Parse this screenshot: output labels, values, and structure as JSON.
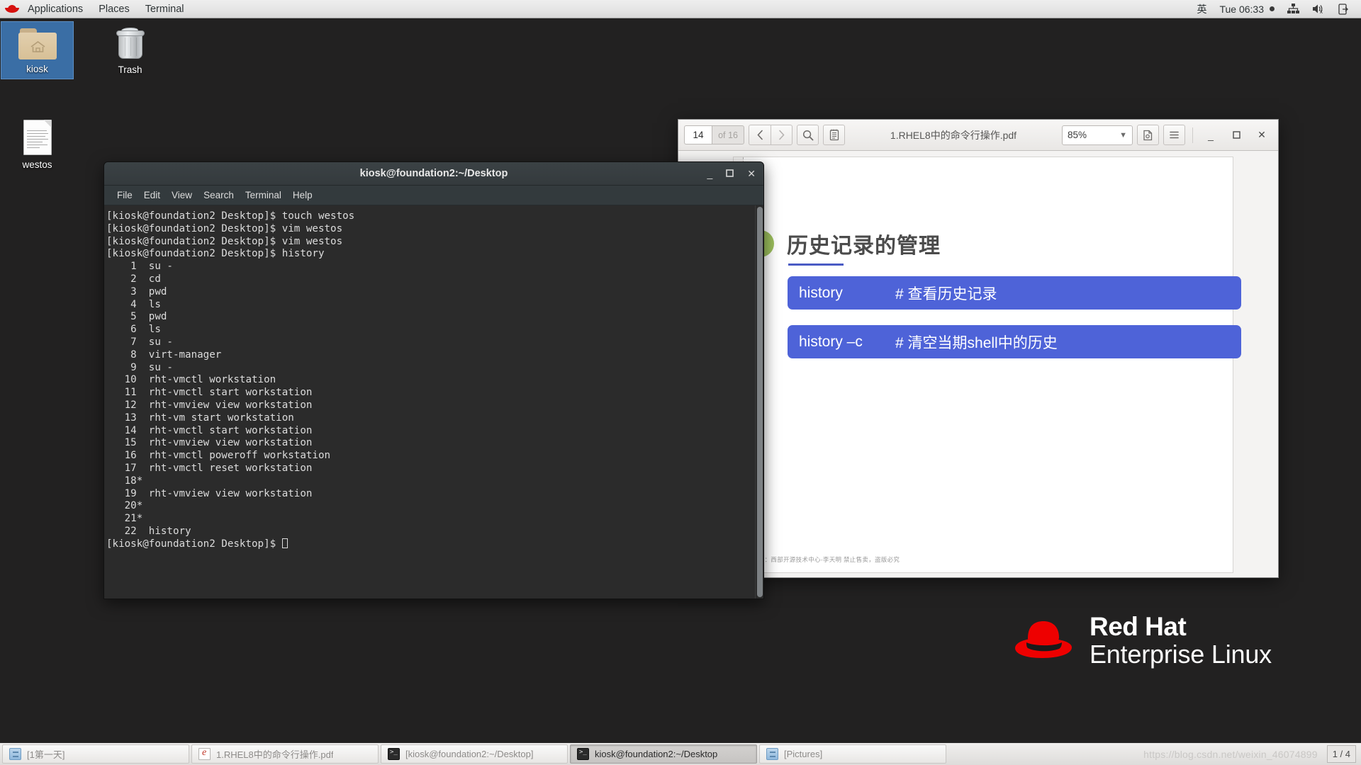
{
  "top_panel": {
    "logo_icon": "redhat-logo-icon",
    "menus": [
      "Applications",
      "Places",
      "Terminal"
    ],
    "input_method": "英",
    "clock": "Tue 06:33",
    "recording_dot": "●",
    "tray_icons": [
      "network-icon",
      "volume-muted-icon",
      "power-eject-icon"
    ]
  },
  "desktop": {
    "icons": [
      {
        "label": "kiosk",
        "icon": "home-folder-icon",
        "selected": true
      },
      {
        "label": "Trash",
        "icon": "trash-icon",
        "selected": false
      },
      {
        "label": "westos",
        "icon": "text-file-icon",
        "selected": false
      }
    ],
    "brand": {
      "line1": "Red Hat",
      "line2": "Enterprise Linux",
      "icon": "redhat-hat-icon"
    }
  },
  "terminal": {
    "title": "kiosk@foundation2:~/Desktop",
    "menus": [
      "File",
      "Edit",
      "View",
      "Search",
      "Terminal",
      "Help"
    ],
    "window_buttons": {
      "minimize": "_",
      "maximize": "❐",
      "close": "✕"
    },
    "lines": [
      "[kiosk@foundation2 Desktop]$ touch westos",
      "[kiosk@foundation2 Desktop]$ vim westos",
      "[kiosk@foundation2 Desktop]$ vim westos",
      "[kiosk@foundation2 Desktop]$ history",
      "    1  su -",
      "    2  cd",
      "    3  pwd",
      "    4  ls",
      "    5  pwd",
      "    6  ls",
      "    7  su -",
      "    8  virt-manager",
      "    9  su -",
      "   10  rht-vmctl workstation",
      "   11  rht-vmctl start workstation",
      "   12  rht-vmview view workstation",
      "   13  rht-vm start workstation",
      "   14  rht-vmctl start workstation",
      "   15  rht-vmview view workstation",
      "   16  rht-vmctl poweroff workstation",
      "   17  rht-vmctl reset workstation",
      "   18*",
      "   19  rht-vmview view workstation",
      "   20*",
      "   21*",
      "   22  history"
    ],
    "prompt": "[kiosk@foundation2 Desktop]$ "
  },
  "pdf_viewer": {
    "page_current": "14",
    "page_total": "of 16",
    "title": "1.RHEL8中的命令行操作.pdf",
    "zoom": "85%",
    "toolbar_icons": [
      "previous-page-icon",
      "next-page-icon",
      "search-icon",
      "annotations-icon",
      "print-preview-icon",
      "menu-icon"
    ],
    "window_buttons": {
      "minimize": "_",
      "maximize": "❐",
      "close": "✕"
    },
    "slide": {
      "heading": "历史记录的管理",
      "rows": [
        {
          "command": "history",
          "note": "# 查看历史记录"
        },
        {
          "command": "history –c",
          "note": "# 清空当期shell中的历史"
        }
      ],
      "footer": "版权：西部开源技术中心-李天明  禁止售卖，盗版必究"
    }
  },
  "taskbar": {
    "items": [
      {
        "label": "[1第一天]",
        "icon": "drawer-icon",
        "active": false
      },
      {
        "label": "1.RHEL8中的命令行操作.pdf",
        "icon": "pdf-icon",
        "active": false
      },
      {
        "label": "[kiosk@foundation2:~/Desktop]",
        "icon": "terminal-icon",
        "active": false
      },
      {
        "label": "kiosk@foundation2:~/Desktop",
        "icon": "terminal-icon",
        "active": true
      },
      {
        "label": "[Pictures]",
        "icon": "drawer-icon",
        "active": false
      }
    ],
    "watermark": "https://blog.csdn.net/weixin_46074899",
    "workspace": "1 / 4"
  },
  "colors": {
    "panel_bg": "#e8e6e4",
    "desktop_bg": "#222121",
    "terminal_bg": "#2b2b2b",
    "selection_blue": "#3a6ea5",
    "slide_blue": "#4e63d8",
    "accent_green": "#9cbf5d",
    "accent_cyan": "#2f9fe0",
    "redhat_red": "#d6110f"
  }
}
